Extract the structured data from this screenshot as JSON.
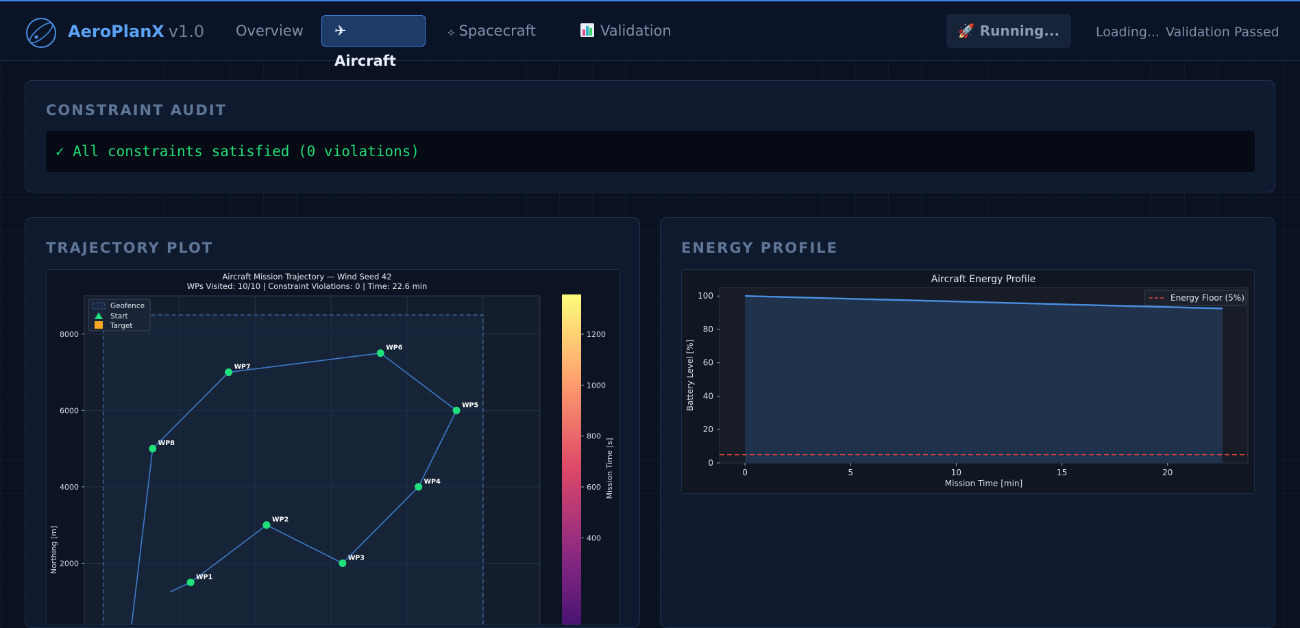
{
  "app": {
    "name": "AeroPlanX",
    "version": "v1.0"
  },
  "nav": {
    "overview": "Overview",
    "aircraft": "✈ Aircraft",
    "spacecraft": "Spacecraft",
    "validation": "Validation"
  },
  "header": {
    "run_button": "🚀 Running...",
    "loading_status": "Loading...",
    "validation_status": "Validation Passed"
  },
  "audit": {
    "title": "CONSTRAINT AUDIT",
    "message": "✓ All constraints satisfied (0 violations)"
  },
  "trajectory": {
    "title": "TRAJECTORY PLOT"
  },
  "energy": {
    "title": "ENERGY PROFILE"
  },
  "colors": {
    "accent": "#3b82f6",
    "success": "#22dd77",
    "waypoint": "#1fe07a",
    "path": "#3d7cc9",
    "energy_line": "#4a90e2",
    "energy_floor": "#e04444"
  },
  "chart_data": [
    {
      "type": "scatter",
      "title": "Aircraft Mission Trajectory — Wind Seed 42",
      "subtitle": "WPs Visited: 10/10 | Constraint Violations: 0 | Time: 22.6 min",
      "xlabel": "",
      "ylabel": "Northing [m]",
      "colorbar_label": "Mission Time [s]",
      "colorbar_ticks": [
        400,
        600,
        800,
        1000,
        1200
      ],
      "colorbar_range": [
        0,
        1356
      ],
      "ylim": [
        0,
        9000
      ],
      "xlim": [
        -500,
        11500
      ],
      "yticks": [
        2000,
        4000,
        6000,
        8000
      ],
      "legend": {
        "placement": "top-left",
        "items": [
          "Geofence",
          "Start",
          "Target"
        ]
      },
      "geofence": {
        "x": [
          0,
          10000
        ],
        "y": [
          0,
          8500
        ]
      },
      "waypoints": [
        {
          "label": "WP1",
          "x": 2300,
          "y": 1500
        },
        {
          "label": "WP2",
          "x": 4300,
          "y": 3000
        },
        {
          "label": "WP3",
          "x": 6300,
          "y": 2000
        },
        {
          "label": "WP4",
          "x": 8300,
          "y": 4000
        },
        {
          "label": "WP5",
          "x": 9300,
          "y": 6000
        },
        {
          "label": "WP6",
          "x": 7300,
          "y": 7500
        },
        {
          "label": "WP7",
          "x": 3300,
          "y": 7000
        },
        {
          "label": "WP8",
          "x": 1300,
          "y": 5000
        }
      ],
      "path_extension": {
        "x": 700,
        "y": 0
      }
    },
    {
      "type": "area",
      "title": "Aircraft Energy Profile",
      "xlabel": "Mission Time [min]",
      "ylabel": "Battery Level [%]",
      "xlim": [
        -1.2,
        23.8
      ],
      "ylim": [
        0,
        105
      ],
      "xticks": [
        0,
        5,
        10,
        15,
        20
      ],
      "yticks": [
        0,
        20,
        40,
        60,
        80,
        100
      ],
      "x": [
        0,
        22.6
      ],
      "y": [
        100,
        92.5
      ],
      "floor": {
        "name": "Energy Floor (5%)",
        "value": 5
      },
      "legend_placement": "top-right"
    }
  ]
}
